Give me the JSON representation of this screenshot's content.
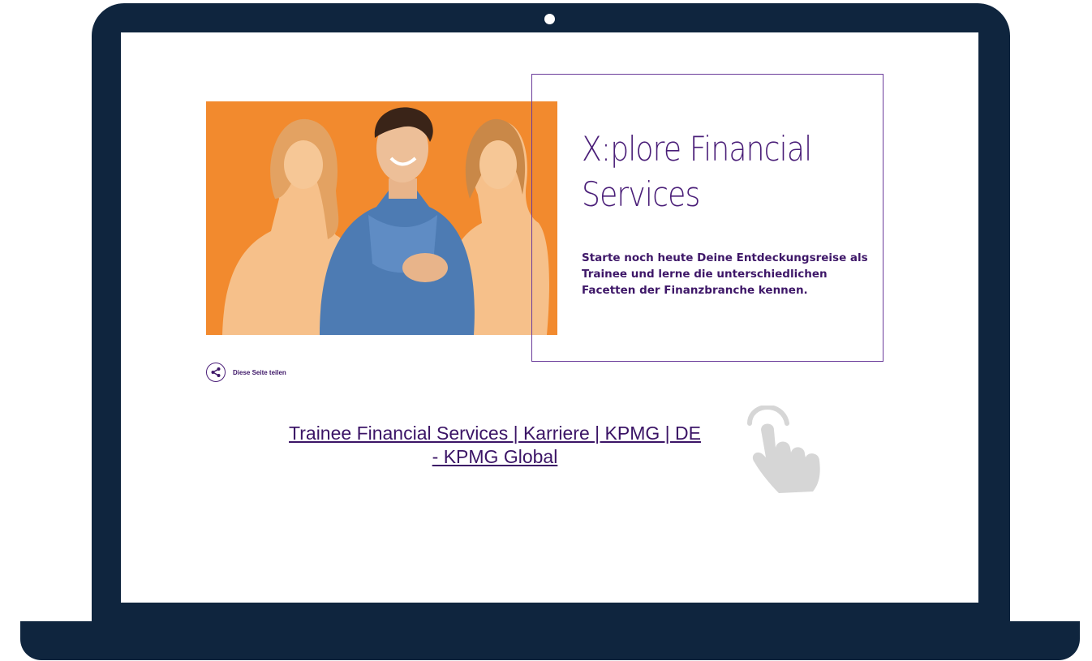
{
  "page": {
    "hero": {
      "title_line1": "X:plore Financial",
      "title_line2": "Services",
      "text_line1": "Starte noch heute Deine Entdeckungsreise als",
      "text_line2": "Trainee und lerne die unterschiedlichen",
      "text_line3": "Facetten der Finanzbranche kennen."
    },
    "share": {
      "label": "Diese Seite teilen",
      "icon": "share-icon"
    }
  },
  "caption": {
    "line1": "Trainee Financial Services | Karriere | KPMG | DE",
    "line2": "- KPMG Global"
  },
  "icons": {
    "pointer": "hand-pointer-icon"
  },
  "colors": {
    "laptop_frame": "#0f253e",
    "hero_background": "#f28a2e",
    "brand_purple": "#4a1e78",
    "link": "#3b1466",
    "hand_icon": "#d6d6d6"
  }
}
